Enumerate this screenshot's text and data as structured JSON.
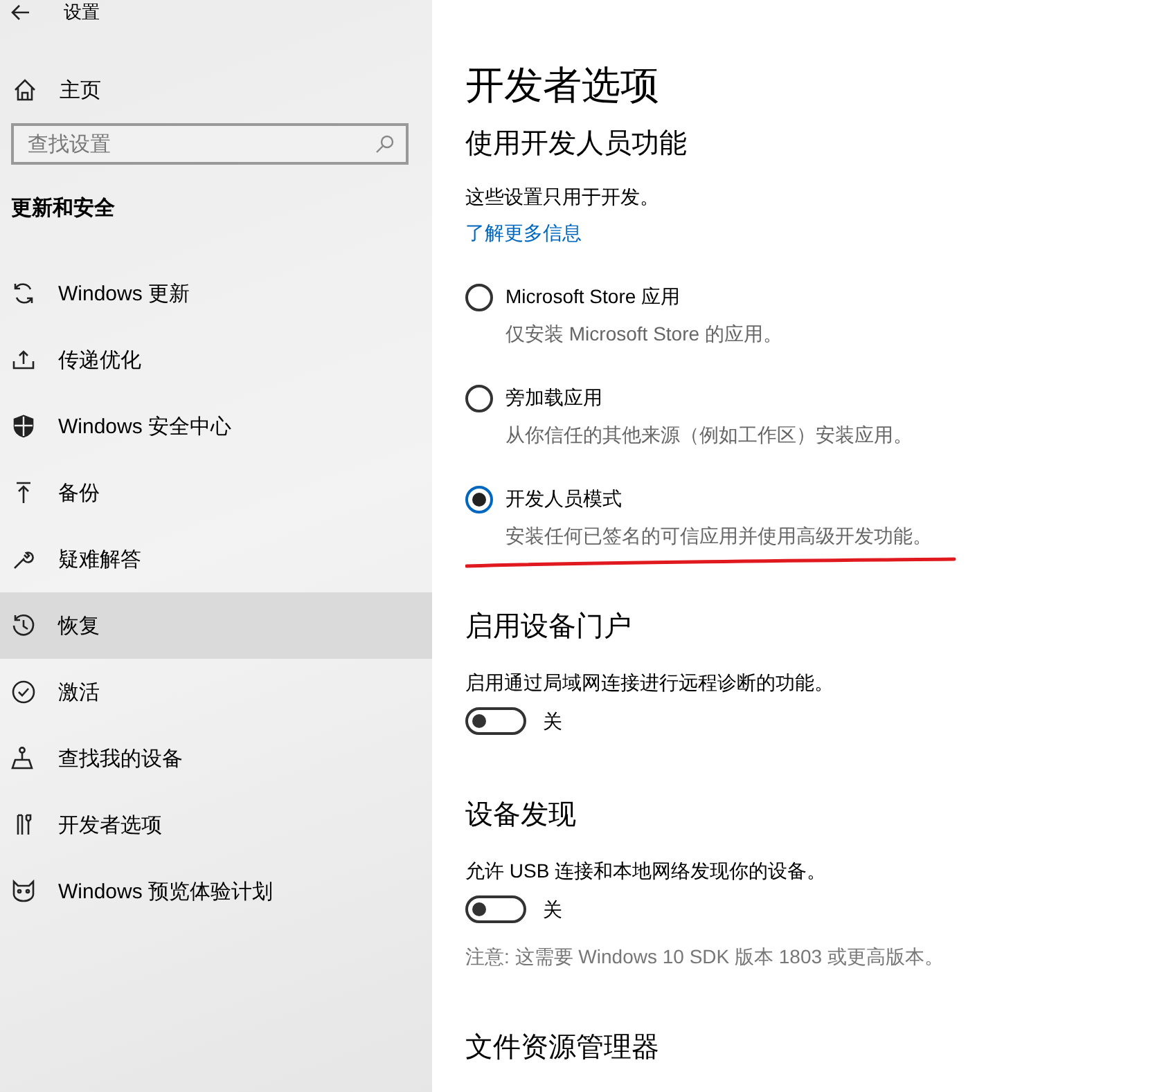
{
  "window": {
    "title": "设置"
  },
  "sidebar": {
    "home": "主页",
    "search": {
      "placeholder": "查找设置"
    },
    "section": "更新和安全",
    "items": [
      {
        "label": "Windows 更新",
        "selected": false
      },
      {
        "label": "传递优化",
        "selected": false
      },
      {
        "label": "Windows 安全中心",
        "selected": false
      },
      {
        "label": "备份",
        "selected": false
      },
      {
        "label": "疑难解答",
        "selected": false
      },
      {
        "label": "恢复",
        "selected": true
      },
      {
        "label": "激活",
        "selected": false
      },
      {
        "label": "查找我的设备",
        "selected": false
      },
      {
        "label": "开发者选项",
        "selected": false
      },
      {
        "label": "Windows 预览体验计划",
        "selected": false
      }
    ]
  },
  "page": {
    "title": "开发者选项",
    "subtitle": "使用开发人员功能",
    "intro": "这些设置只用于开发。",
    "link": "了解更多信息",
    "options": [
      {
        "label": "Microsoft Store 应用",
        "description": "仅安装 Microsoft Store 的应用。",
        "selected": false
      },
      {
        "label": "旁加载应用",
        "description": "从你信任的其他来源（例如工作区）安装应用。",
        "selected": false
      },
      {
        "label": "开发人员模式",
        "description": "安装任何已签名的可信应用并使用高级开发功能。",
        "selected": true,
        "underlined": true
      }
    ],
    "sections": [
      {
        "heading": "启用设备门户",
        "description": "启用通过局域网连接进行远程诊断的功能。",
        "toggle": {
          "on": false,
          "label": "关"
        }
      },
      {
        "heading": "设备发现",
        "description": "允许 USB 连接和本地网络发现你的设备。",
        "toggle": {
          "on": false,
          "label": "关"
        },
        "note": "注意: 这需要 Windows 10 SDK 版本 1803 或更高版本。"
      },
      {
        "heading": "文件资源管理器"
      }
    ]
  }
}
